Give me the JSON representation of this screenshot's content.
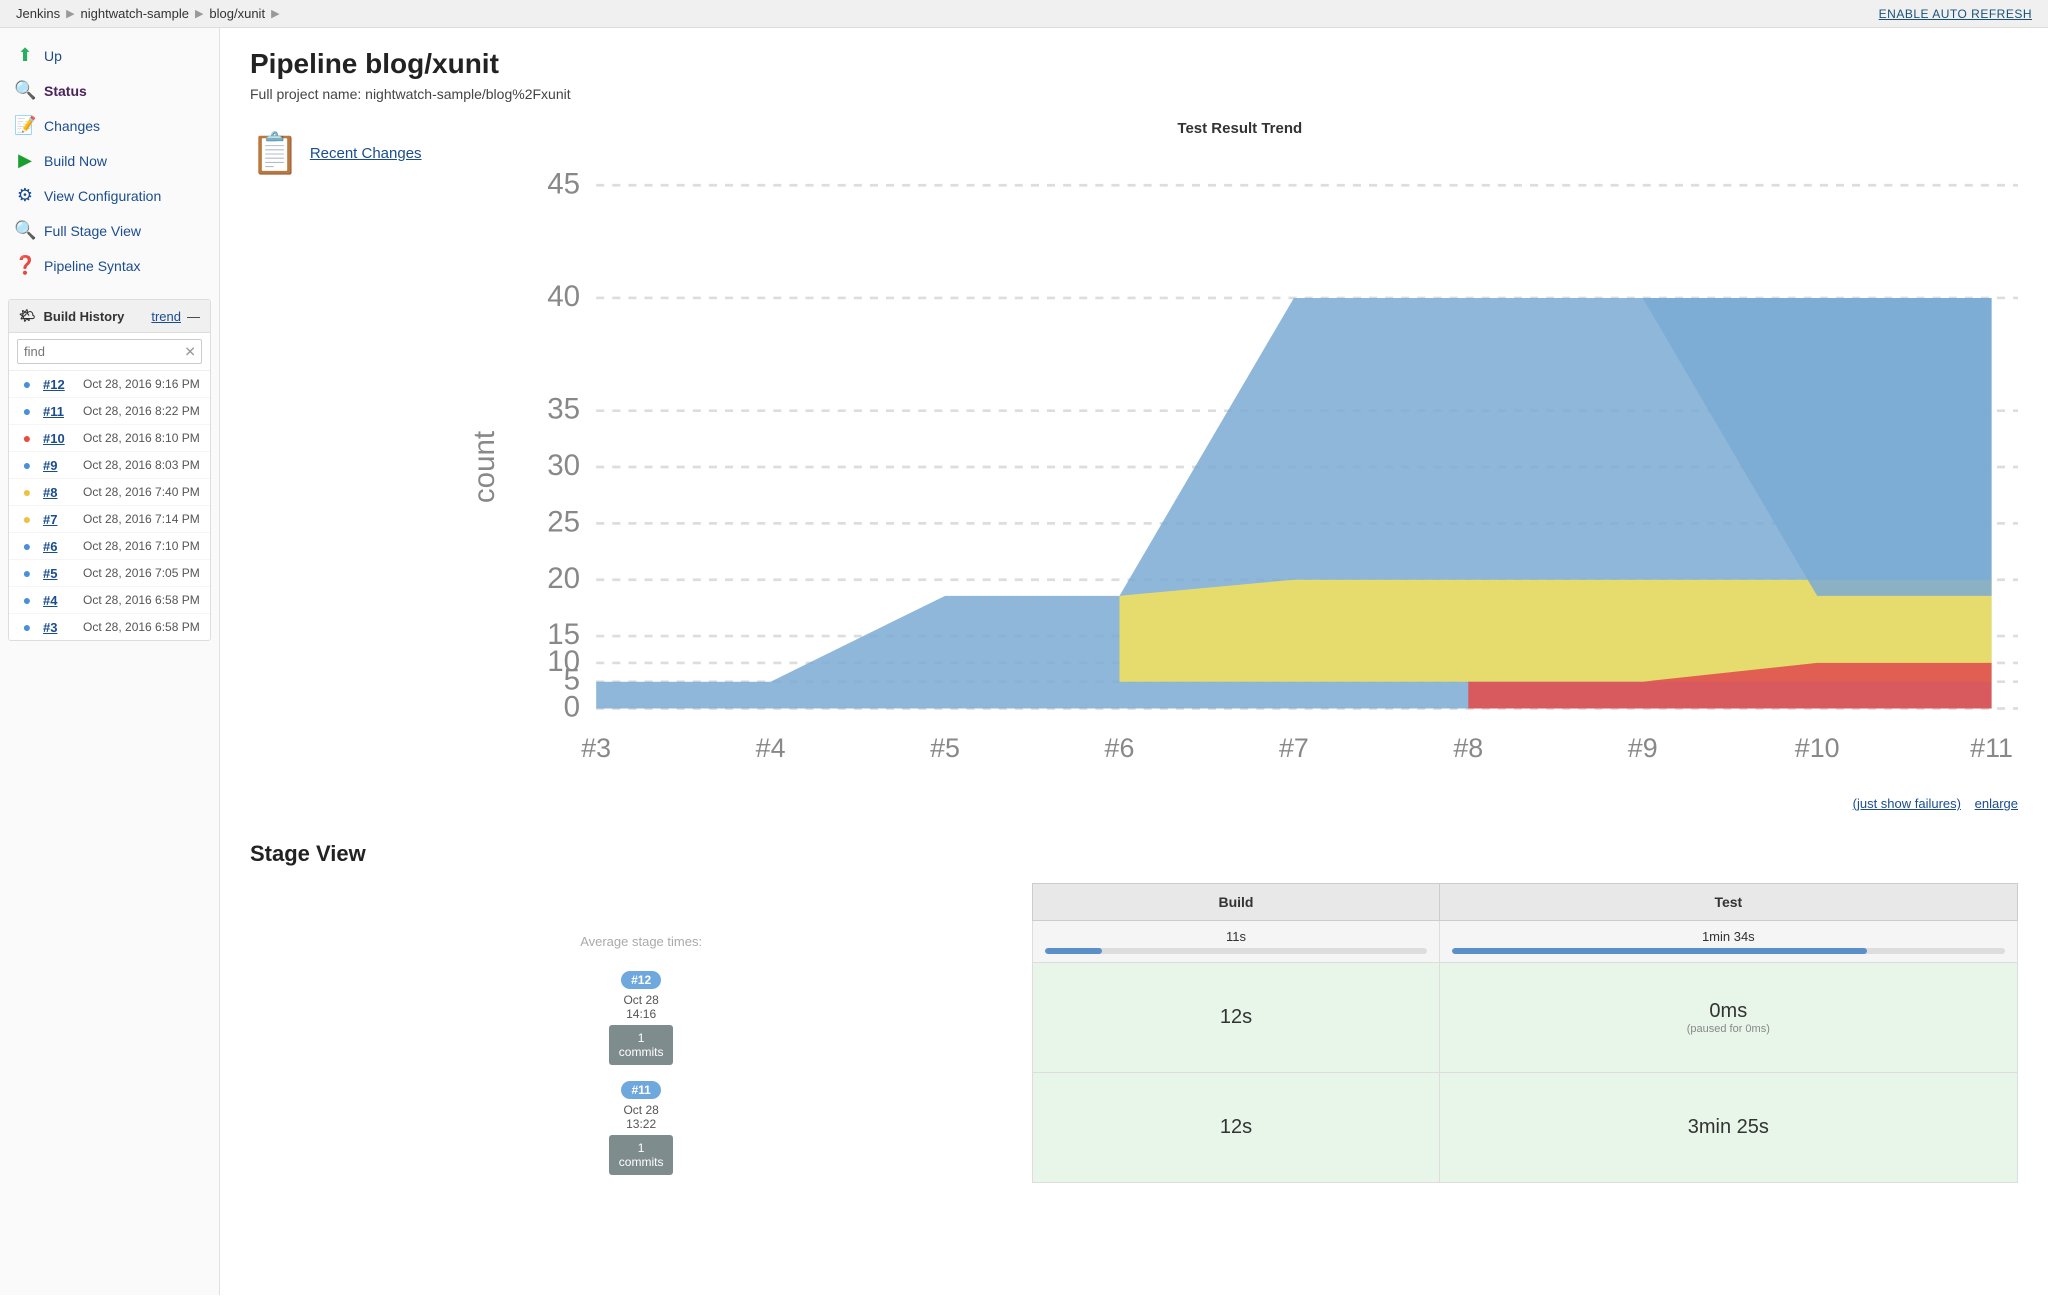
{
  "breadcrumb": {
    "items": [
      "Jenkins",
      "nightwatch-sample",
      "blog/xunit"
    ],
    "autoRefresh": "ENABLE AUTO REFRESH"
  },
  "sidebar": {
    "nav": [
      {
        "id": "up",
        "label": "Up",
        "icon": "⬆",
        "color": "#27ae60",
        "active": false
      },
      {
        "id": "status",
        "label": "Status",
        "icon": "🔍",
        "active": true
      },
      {
        "id": "changes",
        "label": "Changes",
        "icon": "📝",
        "active": false
      },
      {
        "id": "build-now",
        "label": "Build Now",
        "icon": "▶",
        "active": false
      },
      {
        "id": "view-configuration",
        "label": "View Configuration",
        "icon": "⚙",
        "active": false
      },
      {
        "id": "full-stage-view",
        "label": "Full Stage View",
        "icon": "🔍",
        "active": false
      },
      {
        "id": "pipeline-syntax",
        "label": "Pipeline Syntax",
        "icon": "❓",
        "active": false
      }
    ],
    "buildHistory": {
      "title": "Build History",
      "trendLink": "trend",
      "searchPlaceholder": "find",
      "builds": [
        {
          "num": "#12",
          "date": "Oct 28, 2016 9:16 PM",
          "status": "blue"
        },
        {
          "num": "#11",
          "date": "Oct 28, 2016 8:22 PM",
          "status": "blue"
        },
        {
          "num": "#10",
          "date": "Oct 28, 2016 8:10 PM",
          "status": "red"
        },
        {
          "num": "#9",
          "date": "Oct 28, 2016 8:03 PM",
          "status": "blue"
        },
        {
          "num": "#8",
          "date": "Oct 28, 2016 7:40 PM",
          "status": "yellow"
        },
        {
          "num": "#7",
          "date": "Oct 28, 2016 7:14 PM",
          "status": "yellow"
        },
        {
          "num": "#6",
          "date": "Oct 28, 2016 7:10 PM",
          "status": "blue"
        },
        {
          "num": "#5",
          "date": "Oct 28, 2016 7:05 PM",
          "status": "blue"
        },
        {
          "num": "#4",
          "date": "Oct 28, 2016 6:58 PM",
          "status": "blue"
        },
        {
          "num": "#3",
          "date": "Oct 28, 2016 6:58 PM",
          "status": "blue"
        }
      ]
    }
  },
  "main": {
    "title": "Pipeline blog/xunit",
    "fullProjectName": "Full project name: nightwatch-sample/blog%2Fxunit",
    "recentChanges": {
      "label": "Recent Changes",
      "icon": "📋"
    },
    "chart": {
      "title": "Test Result Trend",
      "justShowFailures": "(just show failures)",
      "enlarge": "enlarge",
      "yLabels": [
        "0",
        "5",
        "10",
        "15",
        "20",
        "25",
        "30",
        "35",
        "40",
        "45"
      ],
      "xLabels": [
        "#3",
        "#4",
        "#5",
        "#6",
        "#7",
        "#8",
        "#9",
        "#10",
        "#11"
      ]
    },
    "stageView": {
      "title": "Stage View",
      "columns": [
        "Build",
        "Test"
      ],
      "avgLabel": "Average stage times:",
      "avgBuild": "11s",
      "avgTest": "1min 34s",
      "buildProgressBuild": 15,
      "buildProgressTest": 75,
      "rows": [
        {
          "buildNum": "#12",
          "date": "Oct 28",
          "time": "14:16",
          "commits": "1\ncommits",
          "buildTime": "12s",
          "testTime": "0ms",
          "testSub": "(paused for 0ms)"
        },
        {
          "buildNum": "#11",
          "date": "Oct 28",
          "time": "13:22",
          "commits": "1\ncommits",
          "buildTime": "12s",
          "testTime": "3min 25s",
          "testSub": ""
        }
      ]
    }
  }
}
